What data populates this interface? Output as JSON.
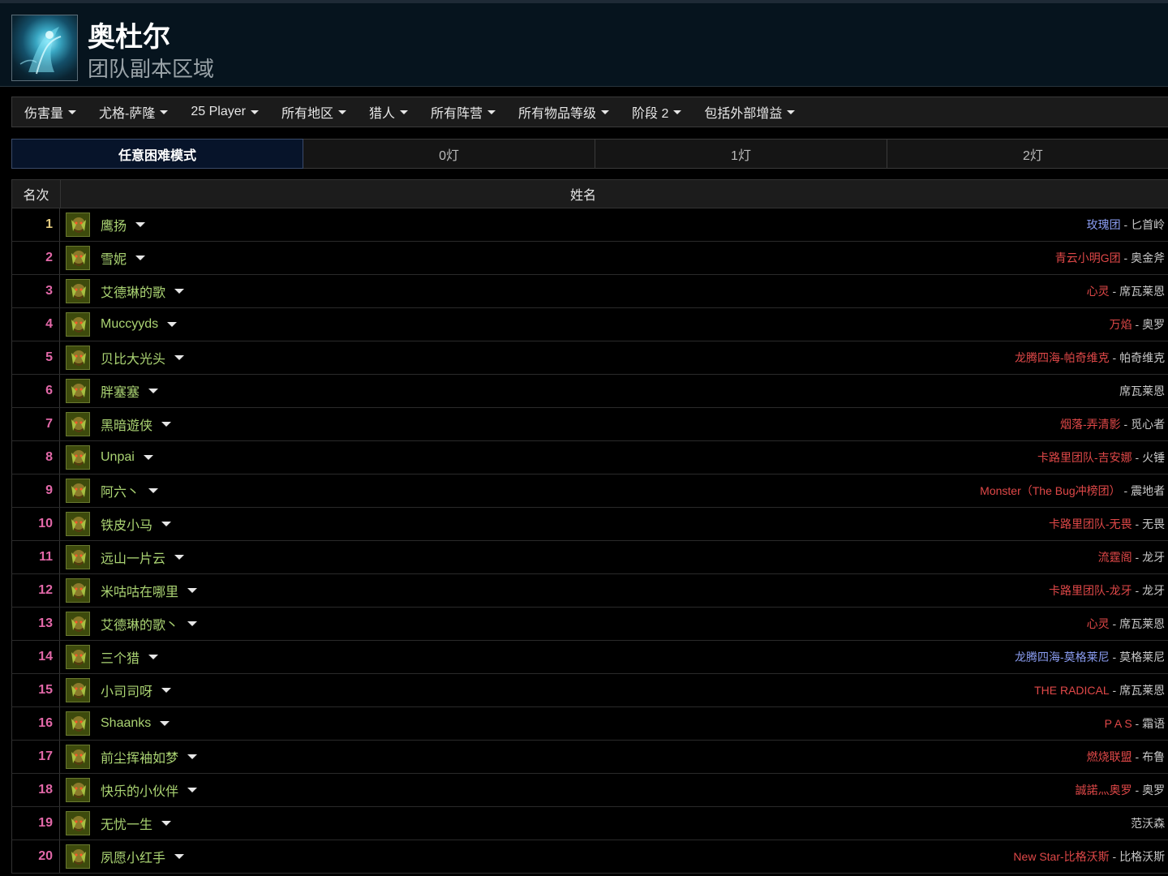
{
  "zone": {
    "title": "奥杜尔",
    "subtitle": "团队副本区域",
    "icon": "ulduar-boss-icon"
  },
  "filters": [
    {
      "label": "伤害量"
    },
    {
      "label": "尤格-萨隆"
    },
    {
      "label": "25 Player"
    },
    {
      "label": "所有地区"
    },
    {
      "label": "猎人"
    },
    {
      "label": "所有阵营"
    },
    {
      "label": "所有物品等级"
    },
    {
      "label": "阶段 2"
    },
    {
      "label": "包括外部增益"
    }
  ],
  "difficulty_tabs": [
    {
      "label": "任意困难模式",
      "active": true
    },
    {
      "label": "0灯",
      "active": false
    },
    {
      "label": "1灯",
      "active": false
    },
    {
      "label": "2灯",
      "active": false
    }
  ],
  "table": {
    "headers": {
      "rank": "名次",
      "name": "姓名"
    },
    "colors": {
      "rank": "#e268a8",
      "rank_first": "#e5cc80",
      "hunter": "#abd473",
      "guild_red": "#e04848",
      "guild_blue": "#8a9cf0"
    },
    "rows": [
      {
        "rank": "1",
        "name": "鹰扬",
        "guild": "玫瑰团",
        "guild_color": "blue",
        "sep": " - ",
        "server": "匕首岭 (E"
      },
      {
        "rank": "2",
        "name": "雪妮",
        "guild": "青云小明G团",
        "guild_color": "red",
        "sep": " - ",
        "server": "奥金斧 (E"
      },
      {
        "rank": "3",
        "name": "艾德琳的歌",
        "guild": "心灵",
        "guild_color": "red",
        "sep": " - ",
        "server": "席瓦莱恩 (E"
      },
      {
        "rank": "4",
        "name": "Muccyyds",
        "guild": "万焰",
        "guild_color": "red",
        "sep": " - ",
        "server": "奥罗 (E"
      },
      {
        "rank": "5",
        "name": "贝比大光头",
        "guild": "龙腾四海-帕奇维克",
        "guild_color": "red",
        "sep": " - ",
        "server": "帕奇维克 (E"
      },
      {
        "rank": "6",
        "name": "胖塞塞",
        "guild": "",
        "guild_color": "red",
        "sep": "",
        "server": "席瓦莱恩 (E"
      },
      {
        "rank": "7",
        "name": "黑暗遊侠",
        "guild": "烟落-弄清影",
        "guild_color": "red",
        "sep": " - ",
        "server": "觅心者 (E"
      },
      {
        "rank": "8",
        "name": "Unpai",
        "guild": "卡路里团队-吉安娜",
        "guild_color": "red",
        "sep": " - ",
        "server": "火锤 (E"
      },
      {
        "rank": "9",
        "name": "阿六丶",
        "guild": "Monster（The Bug冲榜团）",
        "guild_color": "red",
        "sep": " - ",
        "server": "震地者 (E"
      },
      {
        "rank": "10",
        "name": "铁皮小马",
        "guild": "卡路里团队-无畏",
        "guild_color": "red",
        "sep": " - ",
        "server": "无畏 (E"
      },
      {
        "rank": "11",
        "name": "远山一片云",
        "guild": "流霆阁",
        "guild_color": "red",
        "sep": " - ",
        "server": "龙牙 (E"
      },
      {
        "rank": "12",
        "name": "米咕咕在哪里",
        "guild": "卡路里团队-龙牙",
        "guild_color": "red",
        "sep": " - ",
        "server": "龙牙 (E"
      },
      {
        "rank": "13",
        "name": "艾德琳的歌丶",
        "guild": "心灵",
        "guild_color": "red",
        "sep": " - ",
        "server": "席瓦莱恩 (E"
      },
      {
        "rank": "14",
        "name": "三个猎",
        "guild": "龙腾四海-莫格莱尼",
        "guild_color": "blue",
        "sep": " - ",
        "server": "莫格莱尼 (E"
      },
      {
        "rank": "15",
        "name": "小司司呀",
        "guild": "THE RADICAL",
        "guild_color": "red",
        "sep": " - ",
        "server": "席瓦莱恩 (E"
      },
      {
        "rank": "16",
        "name": "Shaanks",
        "guild": "P A S",
        "guild_color": "red",
        "sep": " - ",
        "server": "霜语 (E"
      },
      {
        "rank": "17",
        "name": "前尘挥袖如梦",
        "guild": "燃烧联盟",
        "guild_color": "red",
        "sep": " - ",
        "server": "布鲁 (E"
      },
      {
        "rank": "18",
        "name": "快乐的小伙伴",
        "guild": "誠諾灬奥罗",
        "guild_color": "red",
        "sep": " - ",
        "server": "奥罗 (E"
      },
      {
        "rank": "19",
        "name": "无忧一生",
        "guild": "",
        "guild_color": "red",
        "sep": "",
        "server": "范沃森 (E"
      },
      {
        "rank": "20",
        "name": "夙愿小红手",
        "guild": "New Star-比格沃斯",
        "guild_color": "red",
        "sep": " - ",
        "server": "比格沃斯 (E"
      }
    ]
  }
}
